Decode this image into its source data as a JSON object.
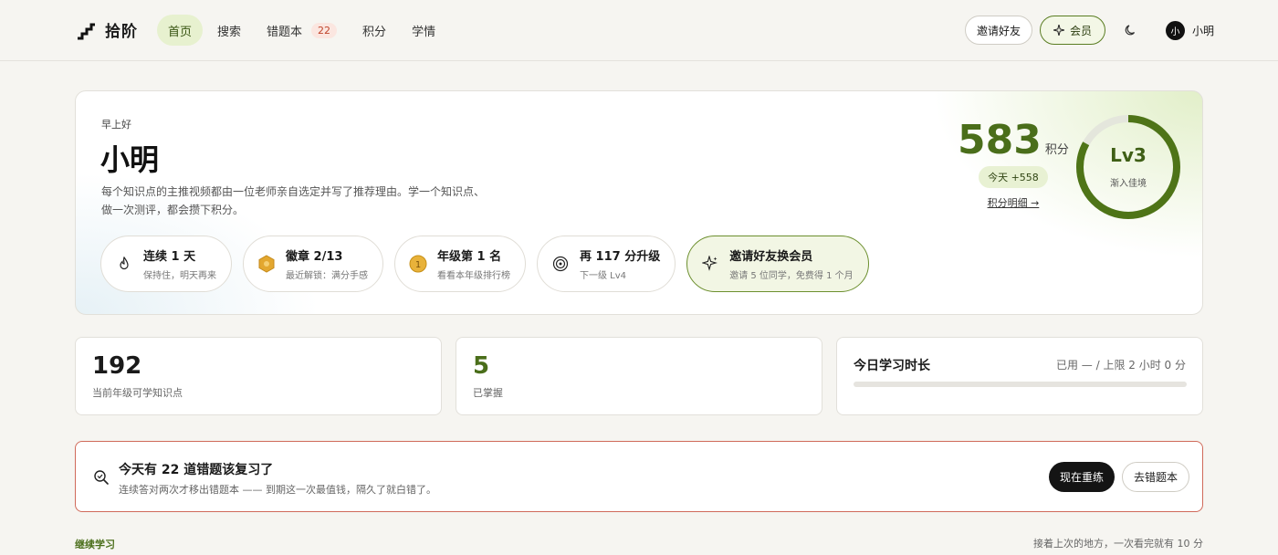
{
  "brand": {
    "name": "拾阶"
  },
  "nav": {
    "home": "首页",
    "search": "搜索",
    "mistakes": "错题本",
    "mistakes_badge": "22",
    "points": "积分",
    "stats": "学情"
  },
  "top": {
    "invite": "邀请好友",
    "member": "会员",
    "avatar_char": "小",
    "user_name": "小明"
  },
  "hero": {
    "greeting": "早上好",
    "name": "小明",
    "desc_line1": "每个知识点的主推视频都由一位老师亲自选定并写了推荐理由。学一个知识点、",
    "desc_line2": "做一次测评，都会攒下积分。",
    "chips": [
      {
        "title": "连续 1 天",
        "sub": "保持住，明天再来",
        "icon": "flame-icon"
      },
      {
        "title": "徽章 2/13",
        "sub": "最近解锁：满分手感",
        "icon": "hexagon-badge-icon"
      },
      {
        "title": "年级第 1 名",
        "sub": "看看本年级排行榜",
        "icon": "gold-medal-icon"
      },
      {
        "title": "再 117 分升级",
        "sub": "下一级 Lv4",
        "icon": "target-icon"
      },
      {
        "title": "邀请好友换会员",
        "sub": "邀请 5 位同学，免费得 1 个月",
        "icon": "sparkle-icon"
      }
    ],
    "score": "583",
    "score_unit": "积分",
    "today_gain": "今天 +558",
    "detail_link": "积分明细 →",
    "level": "Lv3",
    "level_name": "渐入佳境",
    "level_progress": 0.83
  },
  "stats": {
    "available": {
      "value": "192",
      "label": "当前年级可学知识点"
    },
    "mastered": {
      "value": "5",
      "label": "已掌握"
    },
    "time": {
      "title": "今日学习时长",
      "usage": "已用 — / 上限 2 小时 0 分",
      "progress": 0
    }
  },
  "review": {
    "title": "今天有 22 道错题该复习了",
    "sub": "连续答对两次才移出错题本 —— 到期这一次最值钱，隔久了就白错了。",
    "primary": "现在重练",
    "secondary": "去错题本"
  },
  "continue": {
    "label": "继续学习",
    "hint": "接着上次的地方，一次看完就有 10 分"
  },
  "colors": {
    "accent": "#4a6e1a",
    "accent_light": "#e7f1cf",
    "alert_border": "#d06a5a",
    "badge_bg": "#fbe6e0",
    "badge_text": "#c0452c"
  }
}
